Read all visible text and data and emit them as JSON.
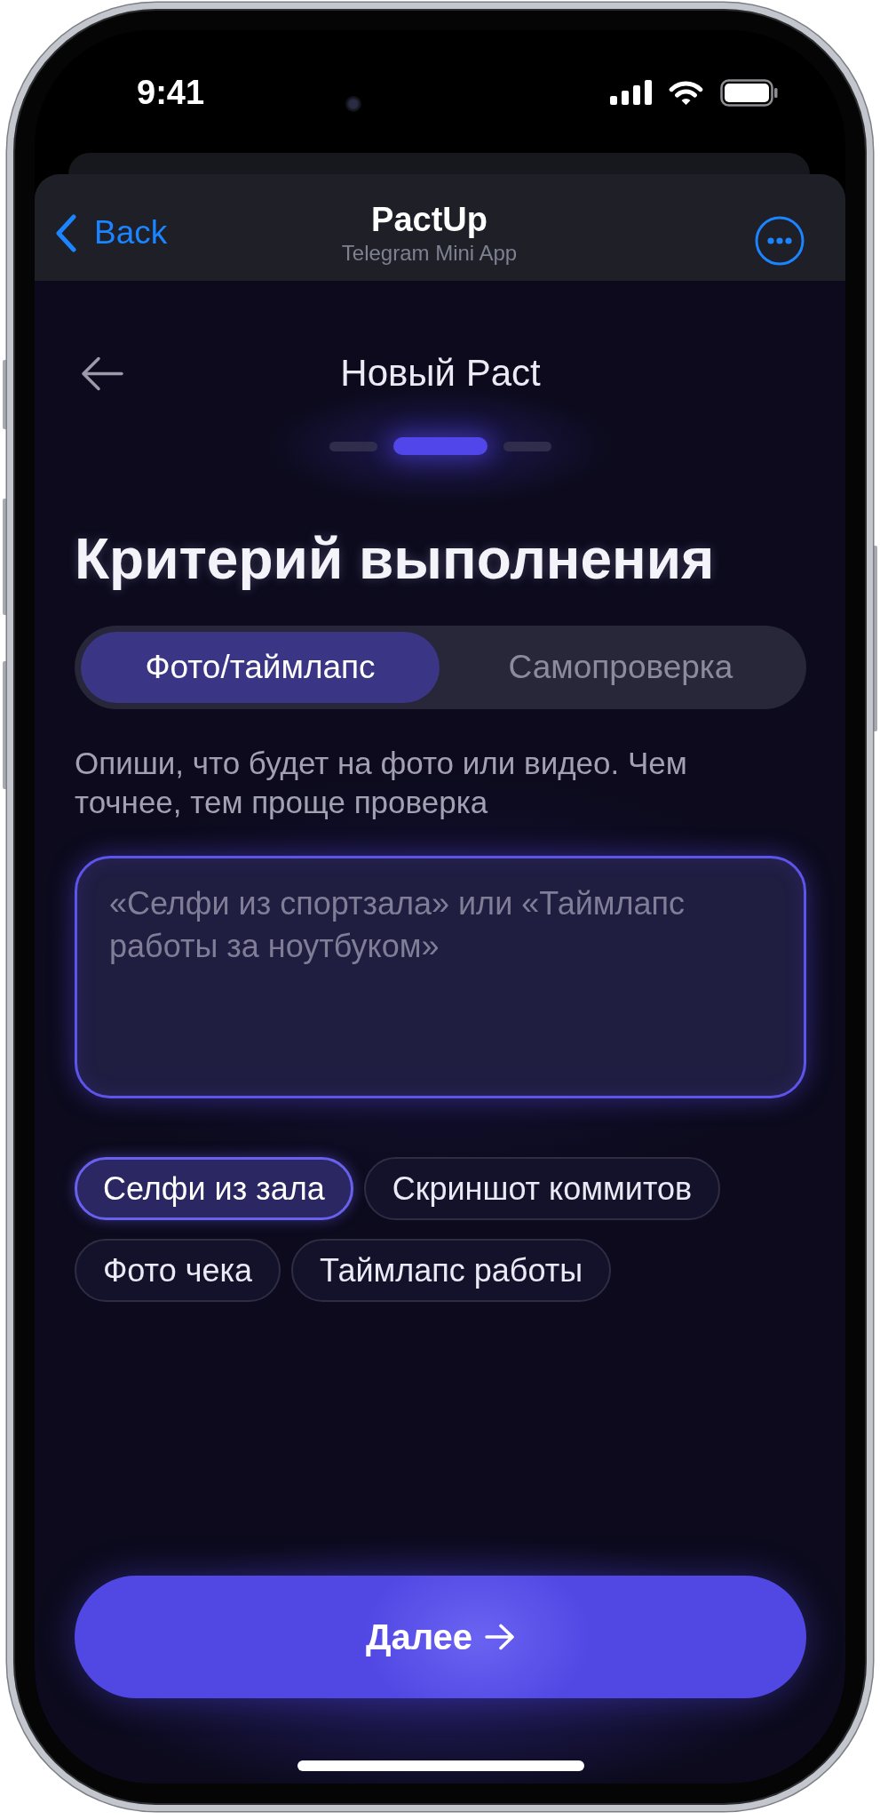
{
  "status_bar": {
    "time": "9:41"
  },
  "telegram_header": {
    "back_label": "Back",
    "title": "PactUp",
    "subtitle": "Telegram Mini App"
  },
  "screen": {
    "title": "Новый Pact",
    "steps": [
      {
        "selected": false
      },
      {
        "selected": true
      },
      {
        "selected": false
      }
    ]
  },
  "heading": "Критерий выполнения",
  "tabs": [
    {
      "label": "Фото/таймлапс",
      "selected": true
    },
    {
      "label": "Самопроверка",
      "selected": false
    }
  ],
  "description": "Опиши, что будет на фото или видео. Чем точнее, тем проще проверка",
  "criterion_field": {
    "placeholder": "«Селфи из спортзала» или «Таймлапс работы за ноутбуком»"
  },
  "suggestions": [
    {
      "label": "Селфи из зала",
      "selected": true
    },
    {
      "label": "Скриншот коммитов",
      "selected": false
    },
    {
      "label": "Фото чека",
      "selected": false
    },
    {
      "label": "Таймлапс работы",
      "selected": false
    }
  ],
  "next_button": {
    "label": "Далее"
  }
}
